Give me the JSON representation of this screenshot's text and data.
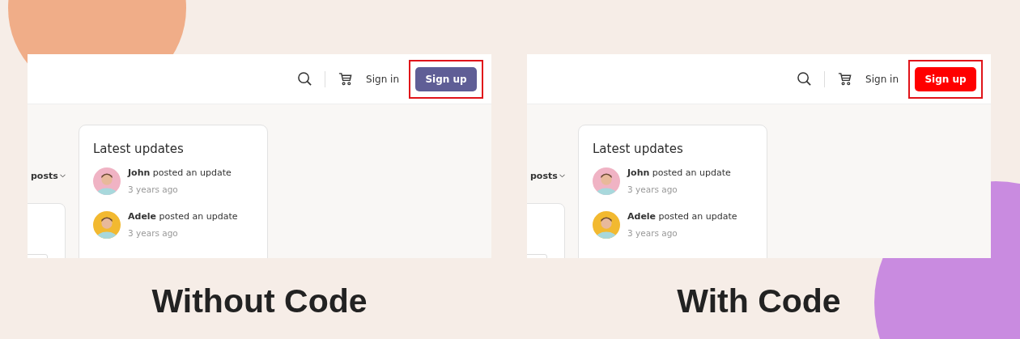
{
  "panels": [
    {
      "header": {
        "sign_in": "Sign in",
        "sign_up": {
          "label": "Sign up",
          "color": "#5f5e96",
          "highlighted": true
        }
      },
      "filter": {
        "label": "posts"
      },
      "updates": {
        "title": "Latest updates",
        "items": [
          {
            "name": "John",
            "action": "posted an update",
            "time": "3 years ago"
          },
          {
            "name": "Adele",
            "action": "posted an update",
            "time": "3 years ago"
          }
        ]
      },
      "caption": "Without Code"
    },
    {
      "header": {
        "sign_in": "Sign in",
        "sign_up": {
          "label": "Sign up",
          "color": "#ff0000",
          "highlighted": true
        }
      },
      "filter": {
        "label": "posts"
      },
      "updates": {
        "title": "Latest updates",
        "items": [
          {
            "name": "John",
            "action": "posted an update",
            "time": "3 years ago"
          },
          {
            "name": "Adele",
            "action": "posted an update",
            "time": "3 years ago"
          }
        ]
      },
      "caption": "With Code"
    }
  ]
}
